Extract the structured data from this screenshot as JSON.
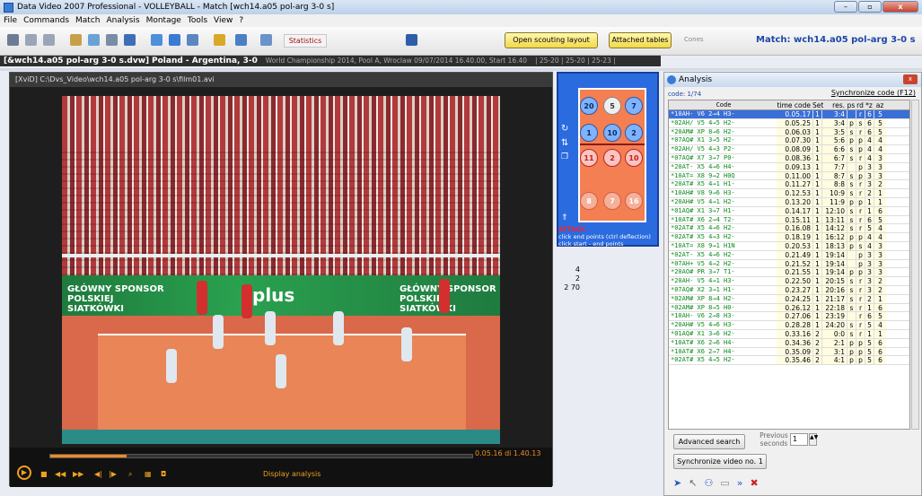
{
  "window": {
    "title": "Data Video 2007 Professional - VOLLEYBALL - Match [wch14.a05 pol-arg 3-0 s]",
    "controls": [
      "–",
      "▫",
      "x"
    ]
  },
  "menu": [
    "File",
    "Commands",
    "Match",
    "Analysis",
    "Montage",
    "Tools",
    "View",
    "?"
  ],
  "toolbar": {
    "statistics": "Statistics",
    "open_scouting": "Open scouting layout",
    "attached_tables": "Attached tables",
    "cones": "Cones",
    "match_label": "Match: wch14.a05 pol-arg 3-0 s"
  },
  "infobar": {
    "file": "[&wch14.a05 pol-arg 3-0 s.dvw]",
    "teams": "Poland - Argentina, 3-0",
    "detail": "World Championship 2014, Pool A, Wroclaw 09/07/2014 16.40.00, Start 16.40",
    "sets": "| 25-20 | 25-20 | 25-23 |"
  },
  "video": {
    "path": "[XviD] C:\\Dvs_Video\\wch14.a05 pol-arg 3-0 s\\film01.avi",
    "timecode": "0.05.16 di 1.40.13",
    "display_analysis": "Display analysis",
    "progress": 0.18,
    "banner_text": [
      "GŁÓWNY SPONSOR POLSKIEJ SIATKÓWKI",
      "plus",
      "GŁÓWNY SPONSOR POLSKIEJ SIATKÓWKI"
    ]
  },
  "court": {
    "top_row": [
      "20",
      "5",
      "7"
    ],
    "mid_row": [
      "1",
      "10",
      "2"
    ],
    "red_row": [
      "11",
      "2",
      "10"
    ],
    "bottom_row": [
      "8",
      "7",
      "16"
    ],
    "attack_label": "ATTACK",
    "attack_note1": "click end points (ctrl deflection)",
    "attack_note2": "click start - end points",
    "side_nums": [
      "4",
      "2",
      "2  70"
    ]
  },
  "analysis": {
    "title": "Analysis",
    "code_count": "code: 1/74",
    "sync_code": "Synchronize code (F12)",
    "headers": {
      "code": "Code",
      "time": "time code",
      "set": "Set",
      "res": "res.",
      "ps": "ps",
      "rd": "rd",
      "z": "*z",
      "az": "az"
    },
    "rows": [
      {
        "code": "*10AH-  V6  2→4  H3-",
        "time": "0.05.17",
        "set": "1",
        "res": "3:4",
        "ps": "",
        "rd": "r",
        "z": "6",
        "az": "5",
        "sel": true
      },
      {
        "code": "*02AH/  V5  4→5  H2-",
        "time": "0.05.25",
        "set": "1",
        "res": "3:4",
        "ps": "p",
        "rd": "s",
        "z": "6",
        "az": "5"
      },
      {
        "code": "*20AM#  XP  8→6  H2-",
        "time": "0.06.03",
        "set": "1",
        "res": "3:5",
        "ps": "s",
        "rd": "r",
        "z": "6",
        "az": "5"
      },
      {
        "code": "*07AQ#  X1  3→5  H2-",
        "time": "0.07.30",
        "set": "1",
        "res": "5:6",
        "ps": "p",
        "rd": "p",
        "z": "4",
        "az": "4"
      },
      {
        "code": "*02AH/  V5  4→3  P2-",
        "time": "0.08.09",
        "set": "1",
        "res": "6:6",
        "ps": "s",
        "rd": "p",
        "z": "4",
        "az": "4"
      },
      {
        "code": "*07AQ#  X7  3→7  P0-",
        "time": "0.08.36",
        "set": "1",
        "res": "6:7",
        "ps": "s",
        "rd": "r",
        "z": "4",
        "az": "3"
      },
      {
        "code": "*20AT-  X5  4→6  H4-",
        "time": "0.09.13",
        "set": "1",
        "res": "7:7",
        "ps": "",
        "rd": "p",
        "z": "3",
        "az": "3"
      },
      {
        "code": "*10AT=  X8  9→2  H0Q",
        "time": "0.11.00",
        "set": "1",
        "res": "8:7",
        "ps": "s",
        "rd": "p",
        "z": "3",
        "az": "3"
      },
      {
        "code": "*20AT#  X5  4→1  H1-",
        "time": "0.11.27",
        "set": "1",
        "res": "8:8",
        "ps": "s",
        "rd": "r",
        "z": "3",
        "az": "2"
      },
      {
        "code": "*10AH#  V8  9→6  H3-",
        "time": "0.12.53",
        "set": "1",
        "res": "10:9",
        "ps": "s",
        "rd": "r",
        "z": "2",
        "az": "1"
      },
      {
        "code": "*20AH#  V5  4→1  H2-",
        "time": "0.13.20",
        "set": "1",
        "res": "11:9",
        "ps": "p",
        "rd": "p",
        "z": "1",
        "az": "1"
      },
      {
        "code": "*01AQ#  X1  3→7  H1-",
        "time": "0.14.17",
        "set": "1",
        "res": "12:10",
        "ps": "s",
        "rd": "r",
        "z": "1",
        "az": "6"
      },
      {
        "code": "*10AT#  X6  2→4  T2-",
        "time": "0.15.11",
        "set": "1",
        "res": "13:11",
        "ps": "s",
        "rd": "r",
        "z": "6",
        "az": "5"
      },
      {
        "code": "*02AT#  X5  4→6  H2-",
        "time": "0.16.08",
        "set": "1",
        "res": "14:12",
        "ps": "s",
        "rd": "r",
        "z": "5",
        "az": "4"
      },
      {
        "code": "*02AT#  X5  4→3  H2-",
        "time": "0.18.19",
        "set": "1",
        "res": "16:12",
        "ps": "p",
        "rd": "p",
        "z": "4",
        "az": "4"
      },
      {
        "code": "*10AT=  X8  9→1  H1N",
        "time": "0.20.53",
        "set": "1",
        "res": "18:13",
        "ps": "p",
        "rd": "s",
        "z": "4",
        "az": "3"
      },
      {
        "code": "*02AT-  X5  4→6  H2-",
        "time": "0.21.49",
        "set": "1",
        "res": "19:14",
        "ps": "",
        "rd": "p",
        "z": "3",
        "az": "3"
      },
      {
        "code": "*07AH+  V5  4→2  H2-",
        "time": "0.21.52",
        "set": "1",
        "res": "19:14",
        "ps": "",
        "rd": "p",
        "z": "3",
        "az": "3"
      },
      {
        "code": "*20AO#  PR  3→7  T1-",
        "time": "0.21.55",
        "set": "1",
        "res": "19:14",
        "ps": "p",
        "rd": "p",
        "z": "3",
        "az": "3"
      },
      {
        "code": "*20AH-  V5  4→1  H3-",
        "time": "0.22.50",
        "set": "1",
        "res": "20:15",
        "ps": "s",
        "rd": "r",
        "z": "3",
        "az": "2"
      },
      {
        "code": "*07AQ#  X2  3→1  H1-",
        "time": "0.23.27",
        "set": "1",
        "res": "20:16",
        "ps": "s",
        "rd": "r",
        "z": "3",
        "az": "2"
      },
      {
        "code": "*02AM#  XP  8→4  H2-",
        "time": "0.24.25",
        "set": "1",
        "res": "21:17",
        "ps": "s",
        "rd": "r",
        "z": "2",
        "az": "1"
      },
      {
        "code": "*02AM#  XP  8→5  H0-",
        "time": "0.26.12",
        "set": "1",
        "res": "22:18",
        "ps": "s",
        "rd": "r",
        "z": "1",
        "az": "6"
      },
      {
        "code": "*10AH-  V6  2→8  H3-",
        "time": "0.27.06",
        "set": "1",
        "res": "23:19",
        "ps": "",
        "rd": "r",
        "z": "6",
        "az": "5"
      },
      {
        "code": "*20AH#  V5  4→6  H3-",
        "time": "0.28.28",
        "set": "1",
        "res": "24:20",
        "ps": "s",
        "rd": "r",
        "z": "5",
        "az": "4"
      },
      {
        "code": "*01AQ#  X1  3→6  H2-",
        "time": "0.33.16",
        "set": "2",
        "res": "0:0",
        "ps": "s",
        "rd": "r",
        "z": "1",
        "az": "1"
      },
      {
        "code": "*10AT#  X6  2→6  H4-",
        "time": "0.34.36",
        "set": "2",
        "res": "2:1",
        "ps": "p",
        "rd": "p",
        "z": "5",
        "az": "6"
      },
      {
        "code": "*10AT#  X6  2→7  H4-",
        "time": "0.35.09",
        "set": "2",
        "res": "3:1",
        "ps": "p",
        "rd": "p",
        "z": "5",
        "az": "6"
      },
      {
        "code": "*02AT#  X5  4→5  H2-",
        "time": "0.35.46",
        "set": "2",
        "res": "4:1",
        "ps": "p",
        "rd": "p",
        "z": "5",
        "az": "6"
      }
    ],
    "advanced_search": "Advanced search",
    "previous_seconds": "Previous seconds",
    "previous_value": "1",
    "sync_video": "Synchronize video no. 1"
  }
}
